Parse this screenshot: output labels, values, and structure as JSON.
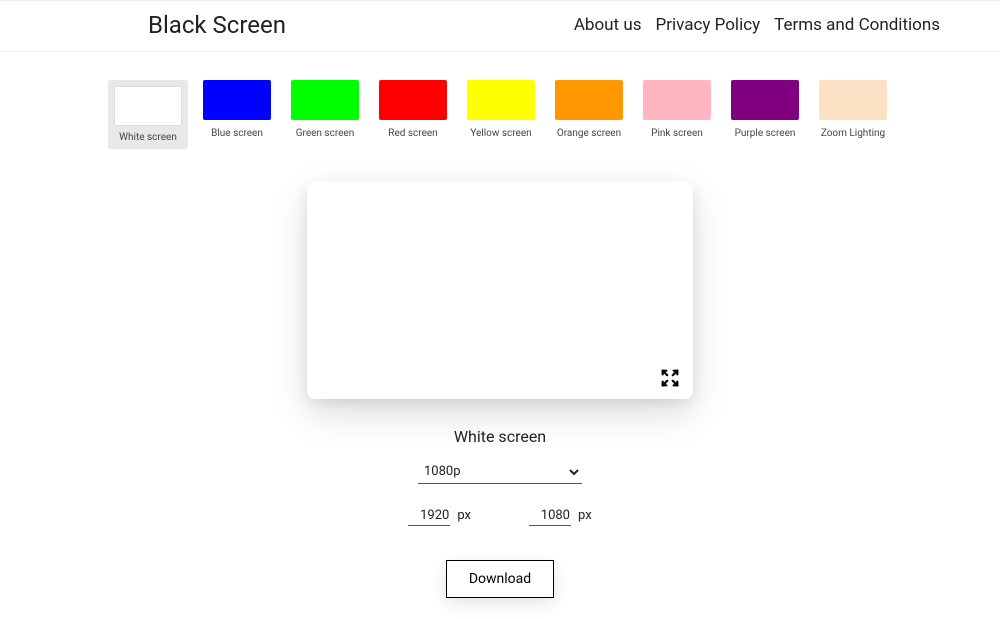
{
  "header": {
    "logo": "Black Screen",
    "nav": {
      "about": "About us",
      "privacy": "Privacy Policy",
      "terms": "Terms and Conditions"
    }
  },
  "swatches": [
    {
      "label": "White screen",
      "color": "#ffffff",
      "selected": true
    },
    {
      "label": "Blue screen",
      "color": "#0000ff"
    },
    {
      "label": "Green screen",
      "color": "#00ff00"
    },
    {
      "label": "Red screen",
      "color": "#ff0000"
    },
    {
      "label": "Yellow screen",
      "color": "#ffff00"
    },
    {
      "label": "Orange screen",
      "color": "#ff9800"
    },
    {
      "label": "Pink screen",
      "color": "#ffb6c1"
    },
    {
      "label": "Purple screen",
      "color": "#800080"
    },
    {
      "label": "Zoom Lighting",
      "color": "#fce0c4"
    }
  ],
  "preview": {
    "title": "White screen",
    "color": "#ffffff"
  },
  "controls": {
    "resolution_selected": "1080p",
    "width": "1920",
    "height": "1080",
    "px_label": "px",
    "download_label": "Download"
  }
}
